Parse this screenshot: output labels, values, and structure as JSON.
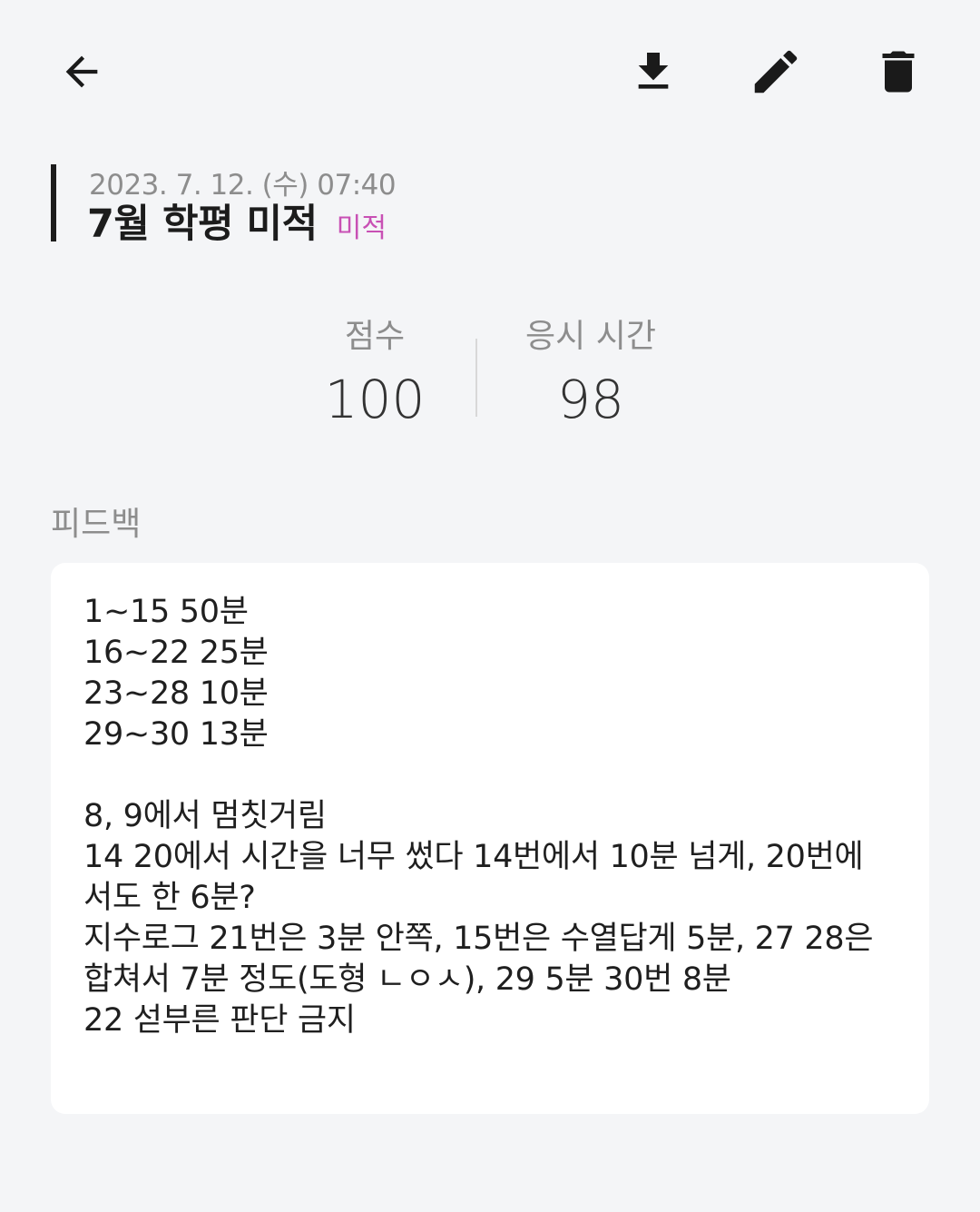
{
  "toolbar": {
    "back_icon": "arrow-left-icon",
    "download_icon": "download-icon",
    "edit_icon": "pencil-icon",
    "delete_icon": "trash-icon"
  },
  "record": {
    "date": "2023. 7. 12. (수) 07:40",
    "title": "7월 학평 미적",
    "category": "미적",
    "category_color": "#c850b4"
  },
  "stats": {
    "score_label": "점수",
    "score_value": "100",
    "time_label": "응시 시간",
    "time_value": "98"
  },
  "feedback": {
    "label": "피드백",
    "lines": [
      "1~15 50분",
      "16~22 25분",
      "23~28 10분",
      "29~30 13분",
      "",
      "8, 9에서 멈칫거림",
      "14 20에서 시간을 너무 썼다 14번에서 10분 넘게, 20번에",
      "서도 한 6분?",
      "지수로그 21번은 3분 안쪽, 15번은 수열답게 5분, 27 28은",
      "합쳐서 7분 정도(도형 ㄴㅇㅅ), 29 5분 30번 8분",
      "22 섣부른 판단 금지"
    ]
  }
}
